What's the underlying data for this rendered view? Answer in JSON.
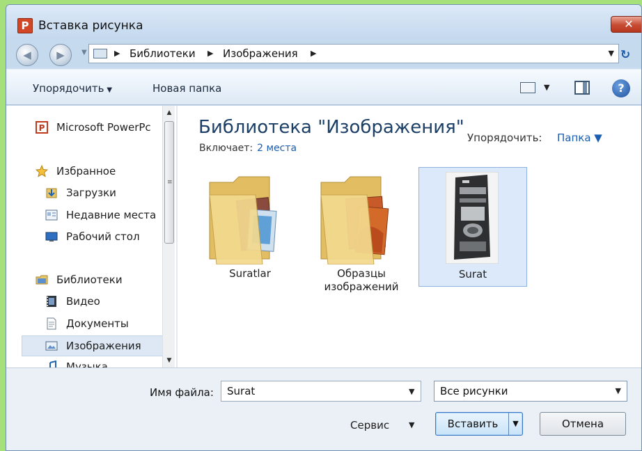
{
  "window": {
    "title": "Вставка рисунка",
    "app_icon_letter": "P",
    "close_glyph": "✕"
  },
  "address": {
    "breadcrumbs": [
      "Библиотеки",
      "Изображения"
    ],
    "separator": "▶",
    "back_glyph": "◀",
    "forward_glyph": "▶",
    "dropdown_glyph": "▼",
    "refresh_glyph": "↻"
  },
  "toolbar": {
    "organize_label": "Упорядочить",
    "new_folder_label": "Новая папка",
    "help_glyph": "?",
    "caret": "▼"
  },
  "nav": {
    "items": [
      {
        "label": "Microsoft PowerPc",
        "icon": "powerpoint-icon"
      },
      {
        "label": "Избранное",
        "icon": "star-icon"
      },
      {
        "label": "Загрузки",
        "icon": "downloads-icon"
      },
      {
        "label": "Недавние места",
        "icon": "recent-places-icon"
      },
      {
        "label": "Рабочий стол",
        "icon": "desktop-icon"
      },
      {
        "label": "Библиотеки",
        "icon": "libraries-icon"
      },
      {
        "label": "Видео",
        "icon": "video-icon"
      },
      {
        "label": "Документы",
        "icon": "documents-icon"
      },
      {
        "label": "Изображения",
        "icon": "pictures-icon"
      },
      {
        "label": "Музыка",
        "icon": "music-icon"
      }
    ],
    "selected": "Изображения",
    "scroll_up": "▲",
    "scroll_down": "▼",
    "grip": "≡"
  },
  "library": {
    "title": "Библиотека \"Изображения\"",
    "includes_label": "Включает:",
    "includes_link": "2 места",
    "arrange_label": "Упорядочить:",
    "arrange_value": "Папка ▼"
  },
  "files": [
    {
      "name": "Suratlar",
      "type": "folder"
    },
    {
      "name": "Образцы изображений",
      "type": "folder"
    },
    {
      "name": "Surat",
      "type": "image",
      "selected": true
    }
  ],
  "bottom": {
    "filename_label": "Имя файла:",
    "filename_value": "Surat",
    "filter_value": "Все рисунки",
    "service_label": "Сервис",
    "insert_label": "Вставить",
    "cancel_label": "Отмена",
    "caret": "▼"
  },
  "colors": {
    "accent": "#1b5db0",
    "frame": "#c9dcef",
    "selection": "#dbe9fa",
    "close_red": "#c74b32"
  }
}
